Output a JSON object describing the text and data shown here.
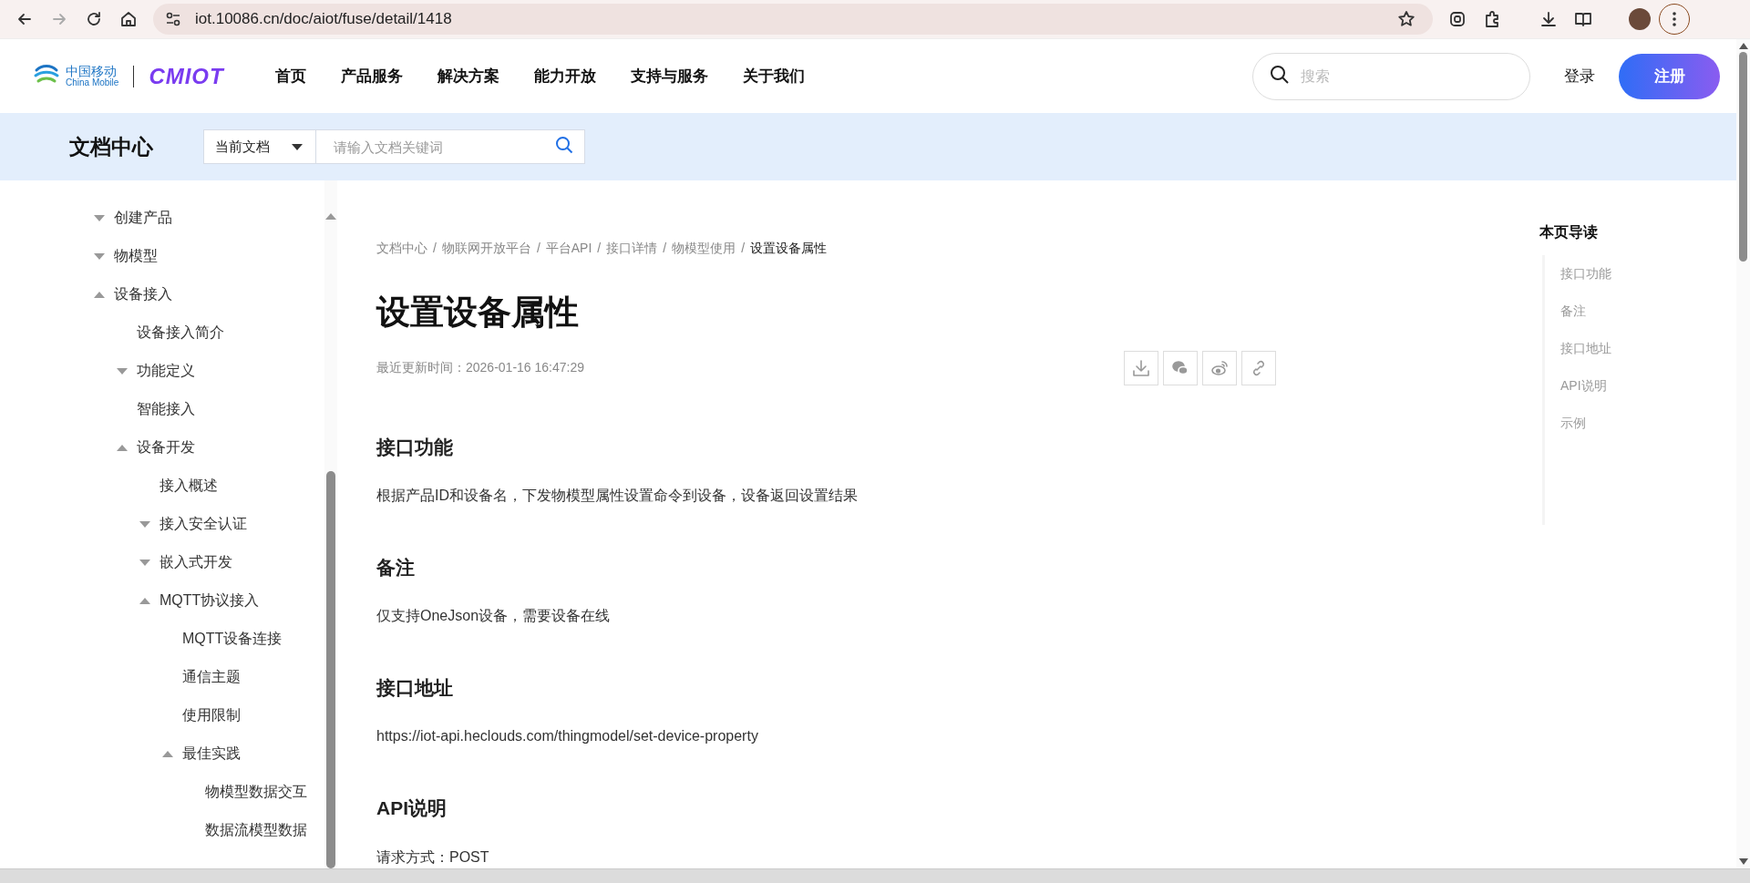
{
  "browser": {
    "url": "iot.10086.cn/doc/aiot/fuse/detail/1418"
  },
  "header": {
    "logo": {
      "name_cn": "中国移动",
      "name_en": "China Mobile",
      "product": "CMIOT"
    },
    "nav": [
      "首页",
      "产品服务",
      "解决方案",
      "能力开放",
      "支持与服务",
      "关于我们"
    ],
    "search": {
      "placeholder": "搜索"
    },
    "login": "登录",
    "register": "注册"
  },
  "doc_bar": {
    "title": "文档中心",
    "scope": "当前文档",
    "search": {
      "placeholder": "请输入文档关键词"
    }
  },
  "sidebar": {
    "items": [
      {
        "label": "创建产品",
        "expanded": false
      },
      {
        "label": "物模型",
        "expanded": false
      },
      {
        "label": "设备接入",
        "expanded": true,
        "children": [
          {
            "label": "设备接入简介"
          },
          {
            "label": "功能定义",
            "expanded": false
          },
          {
            "label": "智能接入"
          },
          {
            "label": "设备开发",
            "expanded": true,
            "children": [
              {
                "label": "接入概述"
              },
              {
                "label": "接入安全认证",
                "expanded": false
              },
              {
                "label": "嵌入式开发",
                "expanded": false
              },
              {
                "label": "MQTT协议接入",
                "expanded": true,
                "children": [
                  {
                    "label": "MQTT设备连接"
                  },
                  {
                    "label": "通信主题"
                  },
                  {
                    "label": "使用限制"
                  },
                  {
                    "label": "最佳实践",
                    "expanded": true,
                    "children": [
                      {
                        "label": "物模型数据交互"
                      },
                      {
                        "label": "数据流模型数据"
                      }
                    ]
                  }
                ]
              }
            ]
          }
        ]
      }
    ]
  },
  "article": {
    "breadcrumb_separator": "/",
    "breadcrumb": [
      "文档中心",
      "物联网开放平台",
      "平台API",
      "接口详情",
      "物模型使用",
      "设置设备属性"
    ],
    "title": "设置设备属性",
    "updated": "最近更新时间：2026-01-16 16:47:29",
    "sections": [
      {
        "heading": "接口功能",
        "text": "根据产品ID和设备名，下发物模型属性设置命令到设备，设备返回设置结果"
      },
      {
        "heading": "备注",
        "text": "仅支持OneJson设备，需要设备在线"
      },
      {
        "heading": "接口地址",
        "text": "https://iot-api.heclouds.com/thingmodel/set-device-property"
      },
      {
        "heading": "API说明",
        "text": "请求方式：POST"
      }
    ]
  },
  "toc": {
    "title": "本页导读",
    "items": [
      "接口功能",
      "备注",
      "接口地址",
      "API说明",
      "示例"
    ]
  }
}
